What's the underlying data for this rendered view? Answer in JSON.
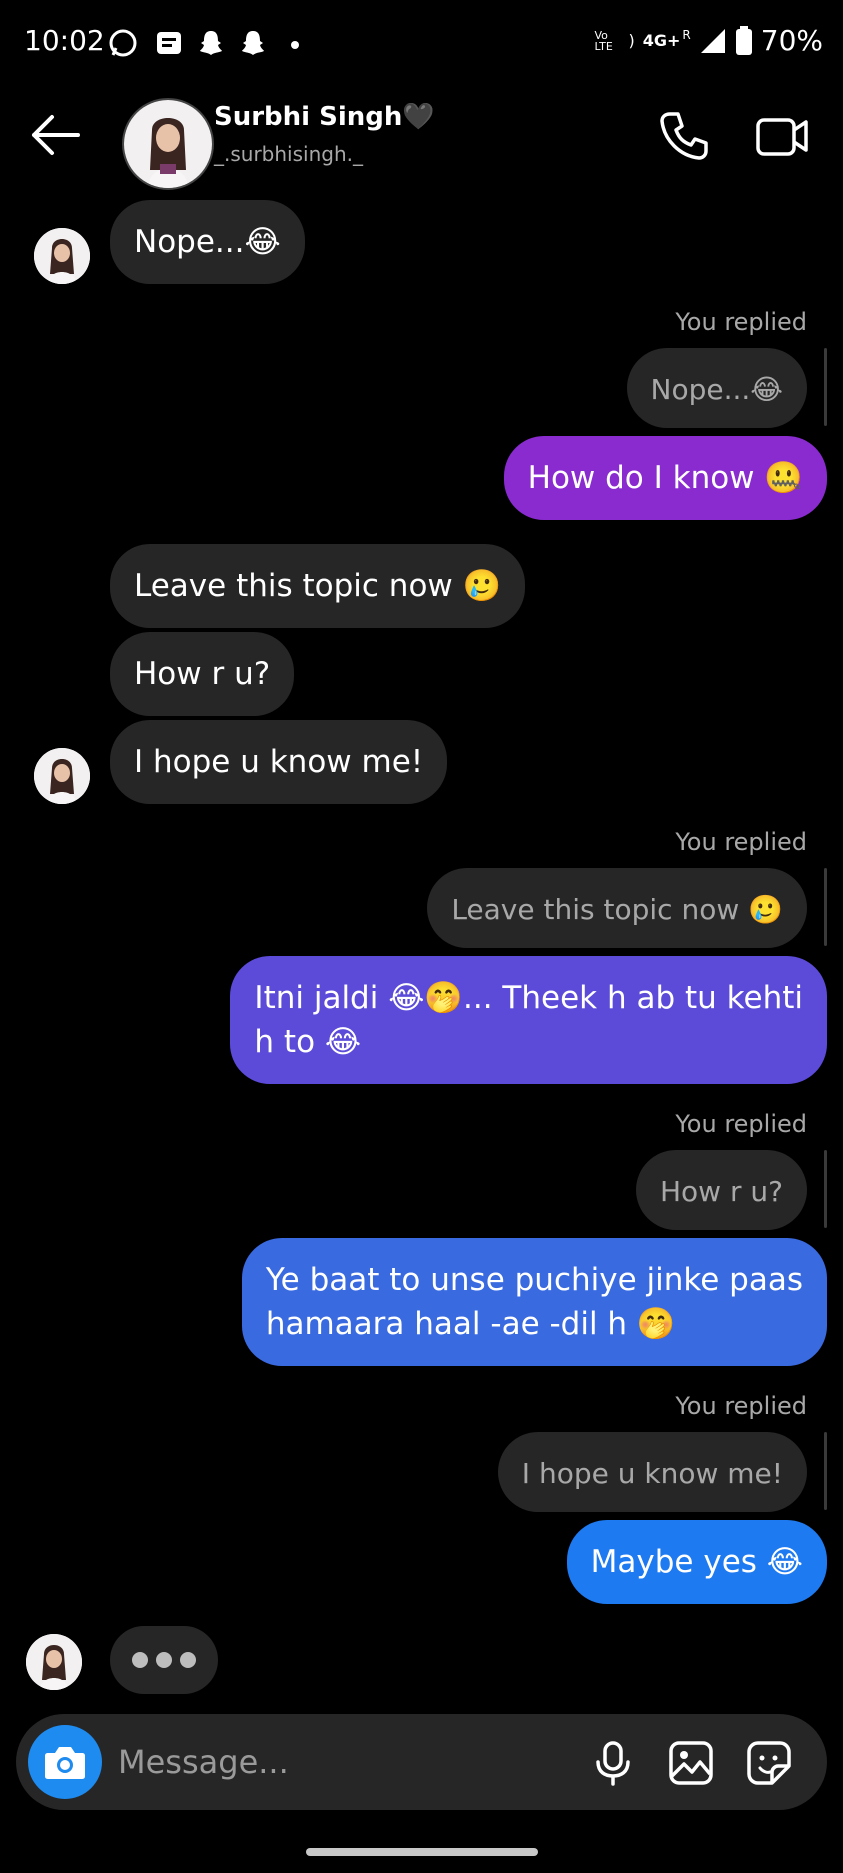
{
  "status": {
    "time": "10:02",
    "network": "4G+",
    "network_sub": "R",
    "volte": "Vo LTE",
    "battery": "70%"
  },
  "header": {
    "name": "Surbhi Singh",
    "heart": "🖤",
    "username": "_.surbhisingh._"
  },
  "messages": {
    "m1": "Nope...😂",
    "r1_label": "You replied",
    "r1_quote": "Nope...😂",
    "r1_text": "How do I know 🤐",
    "m2": "Leave this topic now 🥲",
    "m3": "How r u?",
    "m4": "I hope u know me!",
    "r2_label": "You replied",
    "r2_quote": "Leave this topic now 🥲",
    "r2_text_line1": "Itni jaldi 😂🤭... Theek h ab tu kehti",
    "r2_text_line2": "h to 😂",
    "r3_label": "You replied",
    "r3_quote": "How r u?",
    "r3_text_line1": "Ye baat to unse puchiye jinke paas",
    "r3_text_line2": "hamaara haal -ae -dil h 🤭",
    "r4_label": "You replied",
    "r4_quote": "I hope u know me!",
    "r4_text": "Maybe yes 😂"
  },
  "composer": {
    "placeholder": "Message..."
  },
  "icons": {
    "back": "arrow-left-icon",
    "call": "phone-icon",
    "video": "video-camera-icon",
    "camera": "camera-icon",
    "mic": "microphone-icon",
    "gallery": "image-icon",
    "sticker": "sticker-icon"
  },
  "colors": {
    "accent_blue": "#1E8BF0",
    "bubble_purple": "#8A2BD0",
    "bubble_indigo": "#5B4BD8",
    "bubble_blue": "#3A6AE0",
    "incoming": "#262626"
  }
}
